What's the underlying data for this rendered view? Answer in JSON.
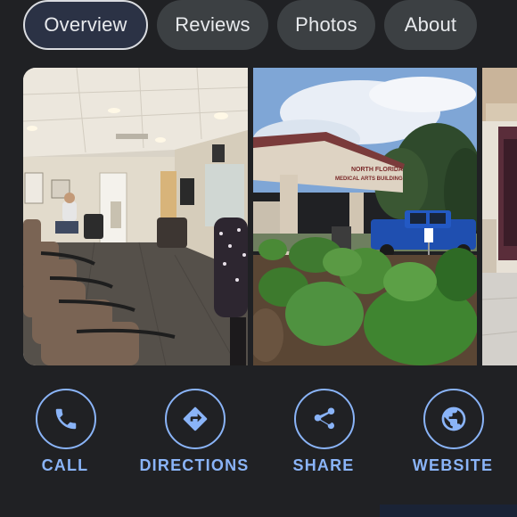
{
  "tabs": [
    {
      "label": "Overview",
      "active": true
    },
    {
      "label": "Reviews",
      "active": false
    },
    {
      "label": "Photos",
      "active": false
    },
    {
      "label": "About",
      "active": false
    }
  ],
  "photos": {
    "items": [
      {
        "name": "waiting-room-photo",
        "signage": ""
      },
      {
        "name": "building-exterior-photo",
        "signage_line1": "NORTH FLORIDA",
        "signage_line2": "MEDICAL ARTS BUILDING"
      },
      {
        "name": "entrance-photo"
      }
    ]
  },
  "actions": [
    {
      "label": "CALL",
      "icon": "phone-icon"
    },
    {
      "label": "DIRECTIONS",
      "icon": "directions-icon"
    },
    {
      "label": "SHARE",
      "icon": "share-icon"
    },
    {
      "label": "WEBSITE",
      "icon": "globe-icon"
    }
  ],
  "colors": {
    "background": "#202124",
    "accent": "#8ab4f8",
    "tab_bg": "#3c4043",
    "tab_active_bg": "#2b3245"
  }
}
